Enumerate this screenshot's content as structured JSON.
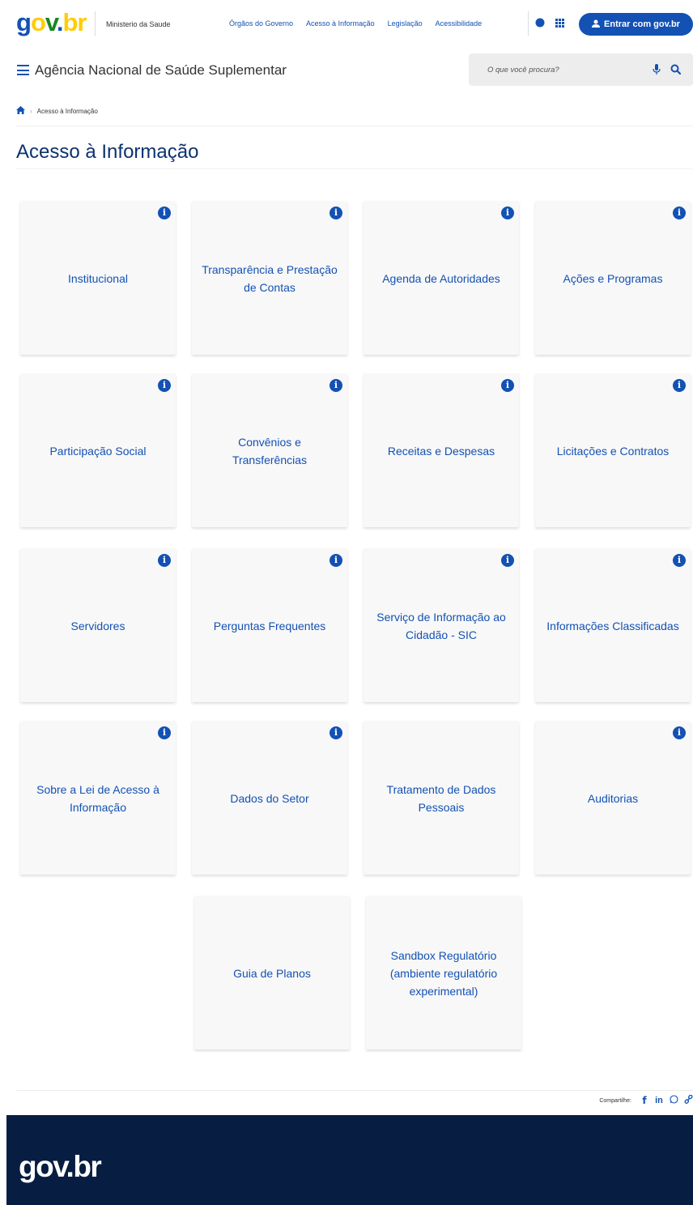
{
  "topbar": {
    "logo": "gov.br",
    "ministry": "Ministerio da Saude",
    "links": [
      "Órgãos do Governo",
      "Acesso à Informação",
      "Legislação",
      "Acessibilidade"
    ],
    "login_label": "Entrar com gov.br"
  },
  "header": {
    "site_title": "Agência Nacional de Saúde Suplementar",
    "search_placeholder": "O que você procura?"
  },
  "breadcrumb": {
    "items": [
      "Acesso à Informação"
    ]
  },
  "page_title": "Acesso à Informação",
  "cards": [
    {
      "label": "Institucional",
      "info": true
    },
    {
      "label": "Transparência e Prestação de Contas",
      "info": true
    },
    {
      "label": "Agenda de Autoridades",
      "info": true
    },
    {
      "label": "Ações e Programas",
      "info": true
    },
    {
      "label": "Participação Social",
      "info": true
    },
    {
      "label": "Convênios e Transferências",
      "info": true
    },
    {
      "label": "Receitas e Despesas",
      "info": true
    },
    {
      "label": "Licitações e Contratos",
      "info": true
    },
    {
      "label": "Servidores",
      "info": true
    },
    {
      "label": "Perguntas Frequentes",
      "info": true
    },
    {
      "label": "Serviço de Informação ao Cidadão - SIC",
      "info": true
    },
    {
      "label": "Informações Classificadas",
      "info": true
    },
    {
      "label": "Sobre a Lei de Acesso à Informação",
      "info": true
    },
    {
      "label": "Dados do Setor",
      "info": true
    },
    {
      "label": "Tratamento de Dados Pessoais",
      "info": false
    },
    {
      "label": "Auditorias",
      "info": true
    },
    {
      "label": "Guia de Planos",
      "info": false
    },
    {
      "label": "Sandbox Regulatório (ambiente regulatório experimental)",
      "info": false
    }
  ],
  "info_glyph": "i",
  "share": {
    "label": "Compartilhe:",
    "icons": [
      "facebook-icon",
      "linkedin-icon",
      "whatsapp-icon",
      "link-icon"
    ]
  },
  "footer": {
    "logo": "gov.br"
  },
  "colors": {
    "primary": "#1351b4",
    "title": "#0c326f",
    "footer_bg": "#071d41",
    "card_bg": "#f8f8f8"
  }
}
